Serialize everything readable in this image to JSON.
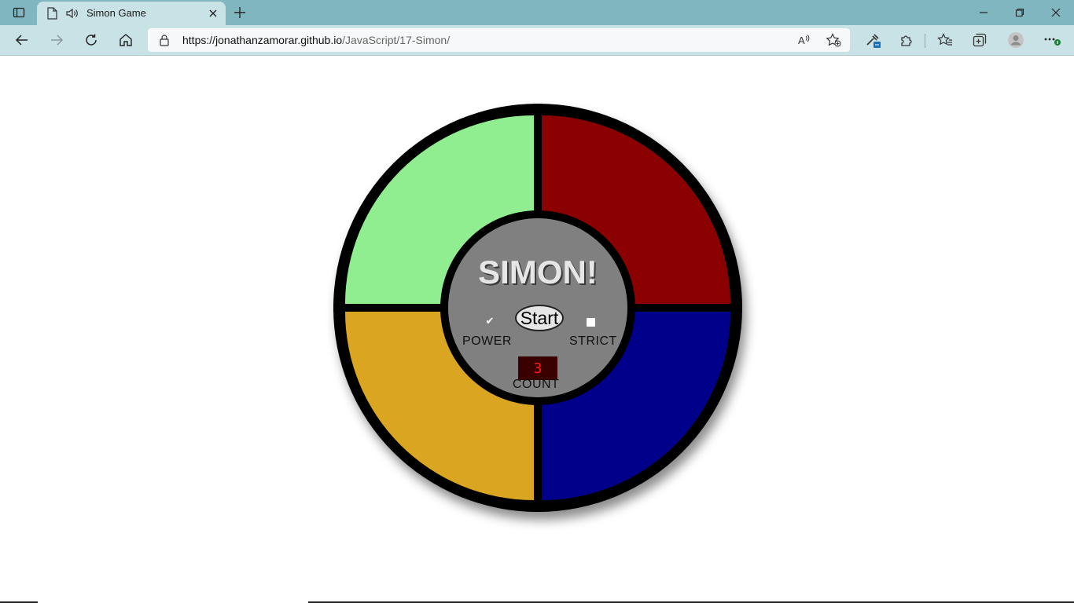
{
  "browser": {
    "tab_title": "Simon Game",
    "url_host": "https://jonathanzamorar.github.io",
    "url_path": "/JavaScript/17-Simon/",
    "icons": {
      "tab_actions": "tab-actions-icon",
      "page": "page-icon",
      "audio": "speaker-icon",
      "close_tab": "close-icon",
      "new_tab": "plus-icon",
      "minimize": "minimize-icon",
      "restore": "restore-icon",
      "close_window": "close-icon",
      "back": "back-arrow-icon",
      "forward": "forward-arrow-icon",
      "refresh": "refresh-icon",
      "home": "home-icon",
      "lock": "lock-icon",
      "read_aloud": "read-aloud-icon",
      "add_favorite": "add-favorite-icon",
      "extension_dropper": "eyedropper-icon",
      "extensions": "puzzle-icon",
      "favorites": "favorites-icon",
      "collections": "collections-icon",
      "profile": "profile-icon",
      "menu": "more-icon"
    }
  },
  "game": {
    "title": "SIMON!",
    "start_label": "Start",
    "power_label": "POWER",
    "strict_label": "STRICT",
    "count_label": "COUNT",
    "count_value": "3",
    "power_on": true,
    "strict_on": false,
    "colors": {
      "green": "#90ee90",
      "red": "#8b0000",
      "yellow": "#daa520",
      "blue": "#00008b",
      "center": "#808080"
    }
  }
}
